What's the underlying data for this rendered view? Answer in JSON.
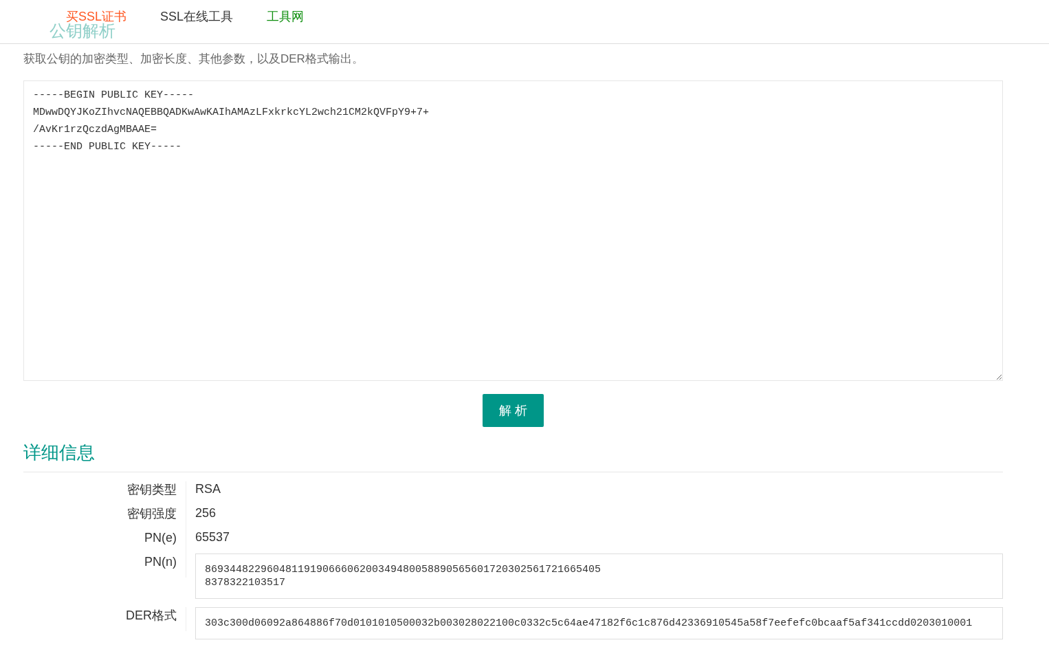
{
  "header": {
    "nav_links": [
      {
        "label": "买SSL证书",
        "color": "#ff5722"
      },
      {
        "label": "SSL在线工具",
        "color": "#333333"
      },
      {
        "label": "工具网",
        "color": "#0f8f0f"
      }
    ],
    "page_title": "公钥解析"
  },
  "description": "获取公钥的加密类型、加密长度、其他参数，以及DER格式输出。",
  "key_input": {
    "value": "-----BEGIN PUBLIC KEY-----\nMDwwDQYJKoZIhvcNAQEBBQADKwAwKAIhAMAzLFxkrkcYL2wch21CM2kQVFpY9+7+\n/AvKr1rzQczdAgMBAAE=\n-----END PUBLIC KEY-----"
  },
  "parse_button": "解 析",
  "details": {
    "title": "详细信息",
    "rows": [
      {
        "kind": "text",
        "label": "密钥类型",
        "value": "RSA"
      },
      {
        "kind": "text",
        "label": "密钥强度",
        "value": "256"
      },
      {
        "kind": "text",
        "label": "PN(e)",
        "value": "65537"
      },
      {
        "kind": "box",
        "label": "PN(n)",
        "value": "8693448229604811919066606200349480058890565601720302561721665405\n8378322103517"
      },
      {
        "kind": "box",
        "label": "DER格式",
        "value": "303c300d06092a864886f70d0101010500032b003028022100c0332c5c64ae47182f6c1c876d42336910545a58f7eefefc0bcaaf5af341ccdd0203010001"
      }
    ]
  }
}
